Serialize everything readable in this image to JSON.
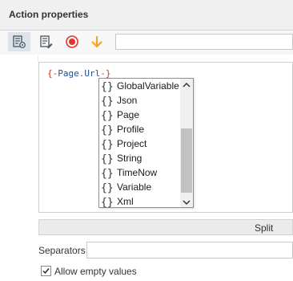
{
  "panel": {
    "title": "Action properties"
  },
  "toolbar": {
    "buttons": [
      {
        "icon": "properties-list-icon",
        "active": true
      },
      {
        "icon": "edit-list-icon",
        "active": false
      },
      {
        "icon": "record-icon",
        "active": false,
        "color": "#e0352b"
      },
      {
        "icon": "arrow-down-icon",
        "active": false,
        "color": "#f5a623"
      }
    ],
    "input_value": ""
  },
  "editor": {
    "code_open": "{-",
    "code_word1": "Page",
    "code_dot": ".",
    "code_word2": "Url",
    "code_close": "-}"
  },
  "autocomplete": {
    "items": [
      "GlobalVariable",
      "Json",
      "Page",
      "Profile",
      "Project",
      "String",
      "TimeNow",
      "Variable",
      "Xml"
    ]
  },
  "split": {
    "label": "Split"
  },
  "separators": {
    "label": "Separators",
    "value": ""
  },
  "allow_empty": {
    "label": "Allow empty values",
    "checked": true
  },
  "colors": {
    "accent": "#1f4e9a",
    "brace": "#c0392b"
  }
}
